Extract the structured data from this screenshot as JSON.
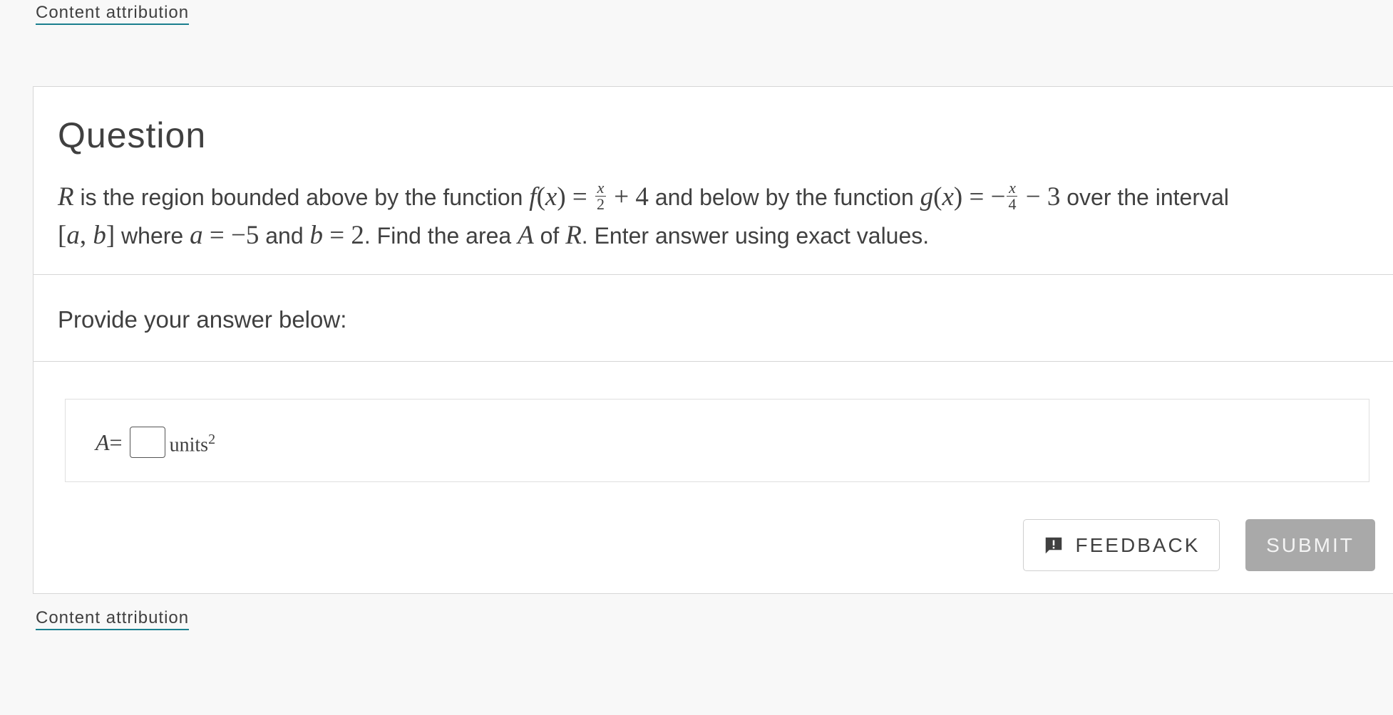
{
  "attribution": {
    "top_label": "Content attribution",
    "bottom_label": "Content attribution"
  },
  "question": {
    "heading": "Question",
    "text": {
      "t1": " is the region bounded above by the function ",
      "f_name": "f",
      "f_open": "(",
      "f_var": "x",
      "f_close": ")",
      "f_eq": " = ",
      "f_num": "x",
      "f_den": "2",
      "f_rest": " + 4",
      "t2": " and below by the function ",
      "g_name": "g",
      "g_open": "(",
      "g_var": "x",
      "g_close": ")",
      "g_eq": " = −",
      "g_num": "x",
      "g_den": "4",
      "g_rest": " − 3",
      "t3": " over the interval ",
      "interval_open": "[",
      "interval_a": "a",
      "interval_sep": ", ",
      "interval_b": "b",
      "interval_close": "]",
      "t4": " where ",
      "a_var": "a",
      "a_val": " = −5",
      "t5": " and ",
      "b_var": "b",
      "b_val": " = 2",
      "t6": ". Find the area ",
      "area_var": "A",
      "t7": " of ",
      "region_var2": "R",
      "t8": ". Enter answer using exact values.",
      "region_var": "R"
    }
  },
  "answer": {
    "prompt": "Provide your answer below:",
    "variable": "A",
    "equals": " =",
    "input_value": "",
    "units": "units",
    "units_exponent": "2"
  },
  "buttons": {
    "feedback_label": "FEEDBACK",
    "submit_label": "SUBMIT"
  },
  "icons": {
    "feedback": "feedback-exclamation-icon"
  }
}
